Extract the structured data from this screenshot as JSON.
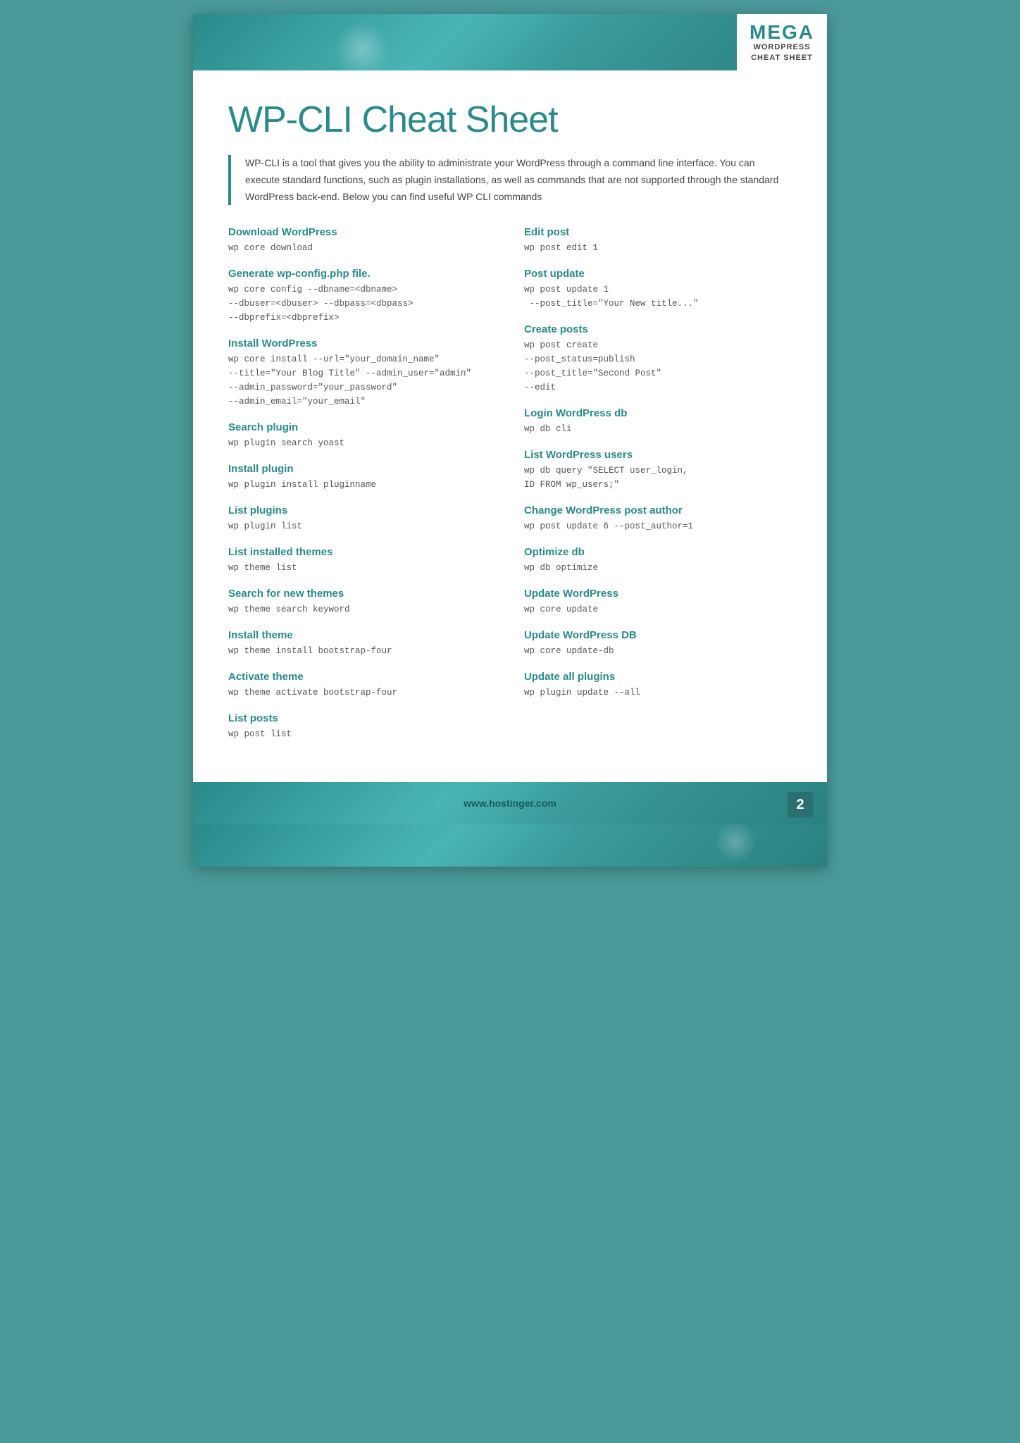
{
  "badge": {
    "mega": "MEGA",
    "line1": "WORDPRESS",
    "line2": "CHEAT SHEET"
  },
  "title": "WP-CLI Cheat Sheet",
  "intro": "WP-CLI is a tool that gives you the ability to administrate your WordPress through a command line interface. You can execute standard functions, such as plugin installations, as well as commands that are not supported through the standard WordPress back-end. Below you can find useful WP CLI commands",
  "footer_url": "www.hostinger.com",
  "page_number": "2",
  "left_commands": [
    {
      "title": "Download WordPress",
      "code": "wp core download"
    },
    {
      "title": "Generate wp-config.php file.",
      "code": "wp core config --dbname=<dbname>\n--dbuser=<dbuser> --dbpass=<dbpass>\n--dbprefix=<dbprefix>"
    },
    {
      "title": "Install WordPress",
      "code": "wp core install --url=\"your_domain_name\"\n--title=\"Your Blog Title\" --admin_user=\"admin\"\n--admin_password=\"your_password\"\n--admin_email=\"your_email\""
    },
    {
      "title": "Search plugin",
      "code": "wp plugin search yoast"
    },
    {
      "title": "Install plugin",
      "code": "wp plugin install pluginname"
    },
    {
      "title": "List plugins",
      "code": "wp plugin list"
    },
    {
      "title": "List installed themes",
      "code": "wp theme list"
    },
    {
      "title": "Search for new themes",
      "code": "wp theme search keyword"
    },
    {
      "title": "Install theme",
      "code": "wp theme install bootstrap-four"
    },
    {
      "title": "Activate theme",
      "code": "wp theme activate bootstrap-four"
    },
    {
      "title": "List posts",
      "code": "wp post list"
    }
  ],
  "right_commands": [
    {
      "title": "Edit post",
      "code": "wp post edit 1"
    },
    {
      "title": "Post update",
      "code": "wp post update 1\n --post_title=\"Your New title...\""
    },
    {
      "title": "Create posts",
      "code": "wp post create\n--post_status=publish\n--post_title=\"Second Post\"\n--edit"
    },
    {
      "title": "Login WordPress db",
      "code": "wp db cli"
    },
    {
      "title": "List WordPress users",
      "code": "wp db query \"SELECT user_login,\nID FROM wp_users;\""
    },
    {
      "title": "Change WordPress post author",
      "code": "wp post update 6 --post_author=1"
    },
    {
      "title": "Optimize db",
      "code": "wp db optimize"
    },
    {
      "title": "Update WordPress",
      "code": "wp core update"
    },
    {
      "title": "Update WordPress DB",
      "code": "wp core update-db"
    },
    {
      "title": "Update all plugins",
      "code": "wp plugin update --all"
    }
  ]
}
